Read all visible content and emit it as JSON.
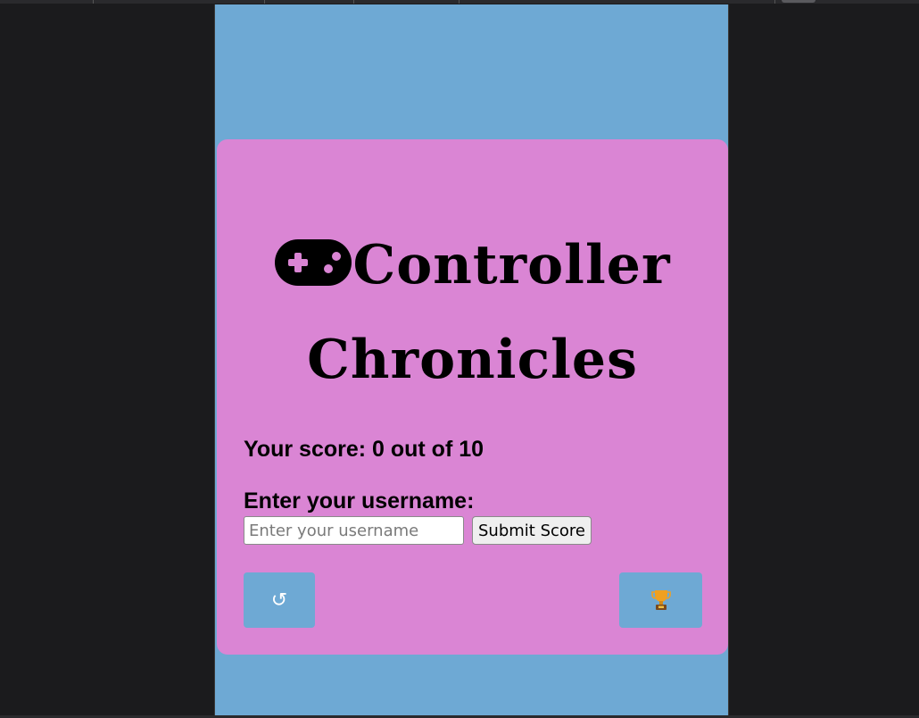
{
  "title": {
    "line1": "Controller",
    "line2": "Chronicles"
  },
  "score_text": "Your score: 0 out of 10",
  "username_label": "Enter your username:",
  "username_input": {
    "value": "",
    "placeholder": "Enter your username"
  },
  "submit_label": "Submit Score",
  "restart_glyph": "↺",
  "colors": {
    "page": "#6ea9d4",
    "card": "#da85d4",
    "button": "#6ea9d4",
    "trophy": "#f0a020"
  },
  "icons": [
    "gamepad-icon",
    "restart-icon",
    "trophy-icon"
  ]
}
